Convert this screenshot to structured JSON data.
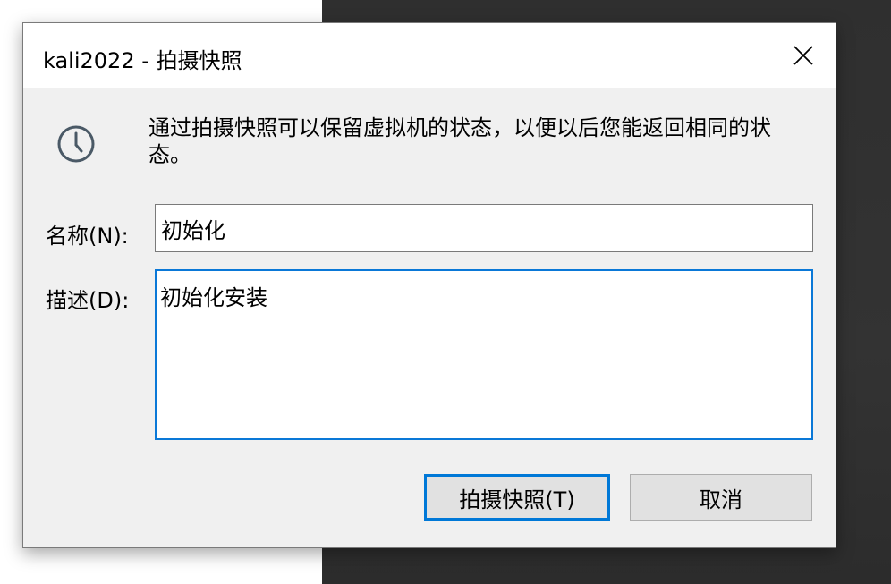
{
  "window": {
    "title": "kali2022 - 拍摄快照"
  },
  "info": {
    "icon": "clock-icon",
    "text": "通过拍摄快照可以保留虚拟机的状态，以便以后您能返回相同的状态。"
  },
  "form": {
    "name_label": "名称(N):",
    "name_value": "初始化",
    "description_label": "描述(D):",
    "description_value": "初始化安装"
  },
  "buttons": {
    "take_snapshot": "拍摄快照(T)",
    "cancel": "取消"
  },
  "colors": {
    "accent": "#0078d7",
    "dialog_bg": "#f0f0f0",
    "titlebar_bg": "#ffffff",
    "background_dark": "#303030"
  }
}
